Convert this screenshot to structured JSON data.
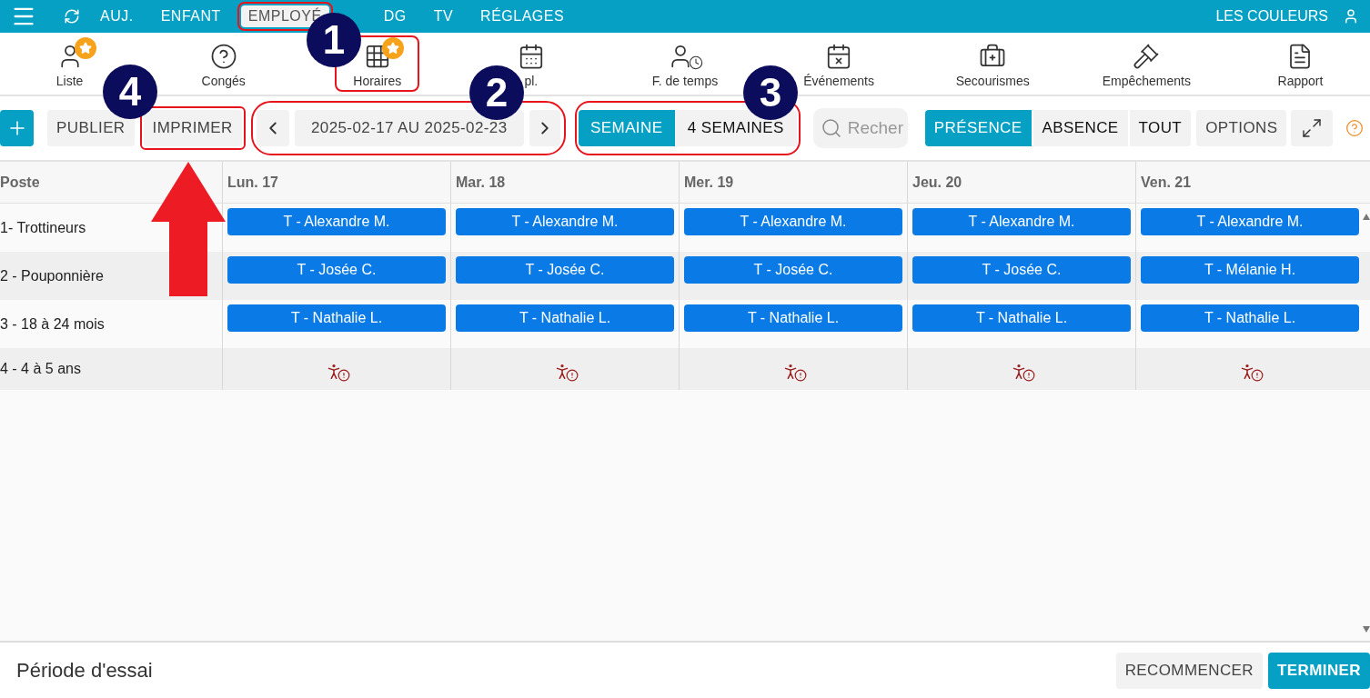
{
  "top_nav": {
    "items": [
      {
        "label": "AUJ.",
        "selected": false,
        "outlined": false
      },
      {
        "label": "ENFANT",
        "selected": false,
        "outlined": false
      },
      {
        "label": "EMPLOYÉ",
        "selected": true,
        "outlined": true
      },
      {
        "label": "DG",
        "selected": false,
        "outlined": false
      },
      {
        "label": "TV",
        "selected": false,
        "outlined": false
      },
      {
        "label": "RÉGLAGES",
        "selected": false,
        "outlined": false
      }
    ],
    "organization": "LES COULEURS"
  },
  "tools": [
    {
      "kind": "list",
      "label": "Liste",
      "starred": true,
      "outlined": false
    },
    {
      "kind": "leave",
      "label": "Congés",
      "starred": false,
      "outlined": false
    },
    {
      "kind": "schedule",
      "label": "Horaires",
      "starred": true,
      "outlined": true
    },
    {
      "kind": "availability",
      "label": "pl.",
      "starred": false,
      "outlined": false
    },
    {
      "kind": "timesheet",
      "label": "F. de temps",
      "starred": false,
      "outlined": false
    },
    {
      "kind": "events",
      "label": "Événements",
      "starred": false,
      "outlined": false
    },
    {
      "kind": "firstaid",
      "label": "Secourismes",
      "starred": false,
      "outlined": false
    },
    {
      "kind": "impediments",
      "label": "Empêchements",
      "starred": false,
      "outlined": false
    },
    {
      "kind": "report",
      "label": "Rapport",
      "starred": false,
      "outlined": false
    }
  ],
  "toolbar": {
    "actions": [
      {
        "label": "PUBLIER",
        "outlined": false
      },
      {
        "label": "IMPRIMER",
        "outlined": true
      }
    ],
    "date_range": {
      "text": "2025-02-17 AU 2025-02-23",
      "outlined": true
    },
    "view_switch": {
      "outlined": true,
      "views": [
        {
          "label": "SEMAINE",
          "selected": true
        },
        {
          "label": "4 SEMAINES",
          "selected": false
        }
      ]
    },
    "search": {
      "placeholder": "Recher"
    },
    "filters": [
      {
        "label": "PRÉSENCE",
        "selected": true
      },
      {
        "label": "ABSENCE",
        "selected": false
      },
      {
        "label": "TOUT",
        "selected": false
      }
    ],
    "options": "OPTIONS"
  },
  "table": {
    "columns": [
      "Poste",
      "Lun. 17",
      "Mar. 18",
      "Mer. 19",
      "Jeu. 20",
      "Ven. 21"
    ],
    "rows": [
      {
        "label": "1- Trottineurs",
        "cells": [
          {
            "kind": "shift",
            "text": "T - Alexandre M."
          },
          {
            "kind": "shift",
            "text": "T - Alexandre M."
          },
          {
            "kind": "shift",
            "text": "T - Alexandre M."
          },
          {
            "kind": "shift",
            "text": "T - Alexandre M."
          },
          {
            "kind": "shift",
            "text": "T - Alexandre M."
          }
        ]
      },
      {
        "label": "2 - Pouponnière",
        "cells": [
          {
            "kind": "shift",
            "text": "T - Josée C."
          },
          {
            "kind": "shift",
            "text": "T - Josée C."
          },
          {
            "kind": "shift",
            "text": "T - Josée C."
          },
          {
            "kind": "shift",
            "text": "T - Josée C."
          },
          {
            "kind": "shift",
            "text": "T - Mélanie H."
          }
        ]
      },
      {
        "label": "3 - 18 à 24 mois",
        "cells": [
          {
            "kind": "shift",
            "text": "T - Nathalie L."
          },
          {
            "kind": "shift",
            "text": "T - Nathalie L."
          },
          {
            "kind": "shift",
            "text": "T - Nathalie L."
          },
          {
            "kind": "shift",
            "text": "T - Nathalie L."
          },
          {
            "kind": "shift",
            "text": "T - Nathalie L."
          }
        ]
      },
      {
        "label": "4 - 4 à 5 ans",
        "cells": [
          {
            "kind": "alert"
          },
          {
            "kind": "alert"
          },
          {
            "kind": "alert"
          },
          {
            "kind": "alert"
          },
          {
            "kind": "alert"
          }
        ]
      }
    ]
  },
  "footer": {
    "title": "Période d'essai",
    "buttons": [
      {
        "label": "RECOMMENCER",
        "primary": false
      },
      {
        "label": "TERMINER",
        "primary": true
      }
    ]
  },
  "annotations": [
    {
      "number": "1"
    },
    {
      "number": "4"
    },
    {
      "number": "2"
    },
    {
      "number": "3"
    }
  ]
}
